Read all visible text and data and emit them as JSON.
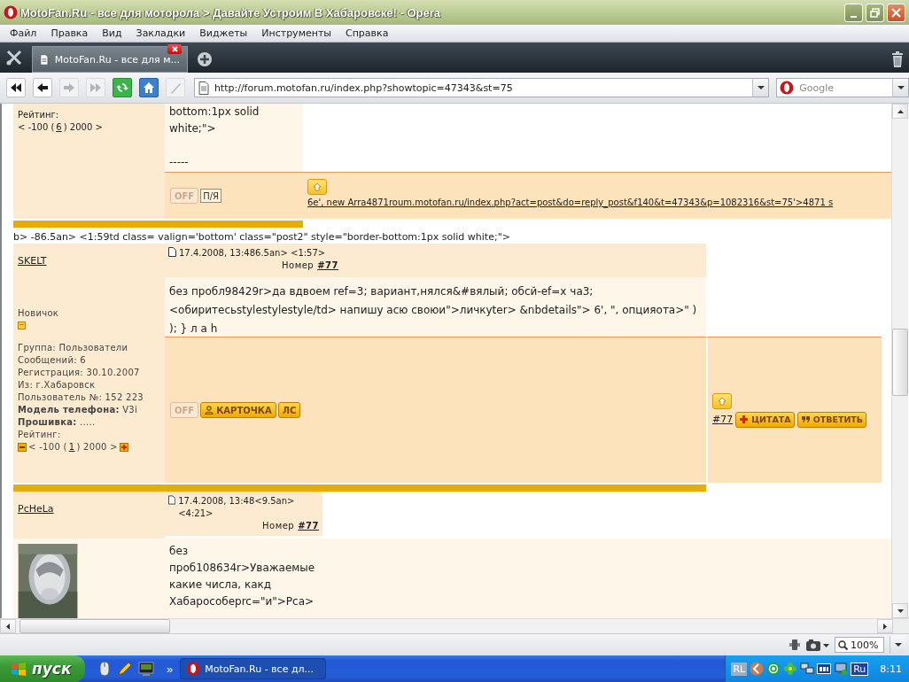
{
  "window": {
    "title": "MotoFan.Ru - все для моторола > Давайте Устроим В Хабаровске! - Opera"
  },
  "menu": [
    "Файл",
    "Правка",
    "Вид",
    "Закладки",
    "Виджеты",
    "Инструменты",
    "Справка"
  ],
  "tabs": [
    {
      "label": "MotoFan.Ru - все для м...",
      "selected": true
    }
  ],
  "nav_buttons": [
    {
      "kind": "rewind",
      "disabled": false
    },
    {
      "kind": "back",
      "disabled": false
    },
    {
      "kind": "forward",
      "disabled": true
    },
    {
      "kind": "fast_forward",
      "disabled": true
    },
    {
      "kind": "reload",
      "disabled": false
    },
    {
      "kind": "home",
      "disabled": false
    },
    {
      "kind": "wand",
      "disabled": true
    }
  ],
  "address": {
    "url": "http://forum.motofan.ru/index.php?showtopic=47343&st=75"
  },
  "search": {
    "placeholder": "Google"
  },
  "page": {
    "fragment": {
      "profile": [
        "Рейтинг:"
      ],
      "rating": {
        "before": "< -100 (",
        "value": "6",
        "after": ") 2000 >",
        "vote_buttons": false
      },
      "message": [
        "bottom:1px solid white;\">",
        "-----"
      ],
      "buttons": [
        {
          "label": "OFF",
          "kind": "status"
        },
        {
          "label": "П/Я",
          "kind": "outline"
        }
      ],
      "link": "6e', new Arra4871roum.motofan.ru/index.php?act=post&do=reply_post&f140&t=47343&p=1082316&st=75'>4871 s"
    },
    "stray_text": "b> -86.5an> <1:59td class= valign='bottom' class=\"post2\" style=\"border-bottom:1px solid white;\">",
    "posts": [
      {
        "author": "SKELT",
        "date": "17.4.2008, 13:486.5an> <1:57>",
        "number_label": "Номер",
        "number": "#77",
        "rank": "Новичок",
        "profile": [
          "Группа: Пользователи",
          "Сообщений: 6",
          "Регистрация: 30.10.2007",
          "Из: г.Хабаровск",
          "Пользователь №: 152 223",
          "**Модель телефона:** V3i",
          "**Прошивка:** .....",
          "Рейтинг:"
        ],
        "rating": {
          "before": "< -100 (",
          "value": "1",
          "after": ") 2000 >",
          "vote_buttons": true
        },
        "message": "без пробл98429r>да вдвоем ref=3; вариант,нялся&#вялый; обсй-ef=x ча3; <обиритесьstylestylestyle/td> напишу асю своюи\">личкуter> &nbdetails\"> 6', \", опцияота>\" ) ); } л а h",
        "buttons": [
          {
            "label": "OFF",
            "kind": "status"
          },
          {
            "label": "КАРТОЧКА",
            "kind": "profile"
          },
          {
            "label": "ЛС",
            "kind": "gold"
          }
        ],
        "post_link": "#77",
        "actions": [
          {
            "label": "ЦИТАТА",
            "kind": "quote"
          },
          {
            "label": "ОТВЕТИТЬ",
            "kind": "reply"
          }
        ]
      },
      {
        "author": "PcHeLa",
        "date": "17.4.2008, 13:48<9.5an> <4:21>",
        "number_label": "Номер",
        "number": "#77",
        "message": "без проб108634r>Уважаемые какие числа, какд Хабарособерrc=\"и\">Рса>"
      }
    ]
  },
  "status_bar": {
    "zoom": "100%"
  },
  "taskbar": {
    "start": "пуск",
    "chevron": "»",
    "windows": [
      {
        "label": "MotoFan.Ru - все дл...",
        "selected": true
      }
    ],
    "language_bar": "RL",
    "keyboard": "Ru",
    "clock": "8:11"
  }
}
